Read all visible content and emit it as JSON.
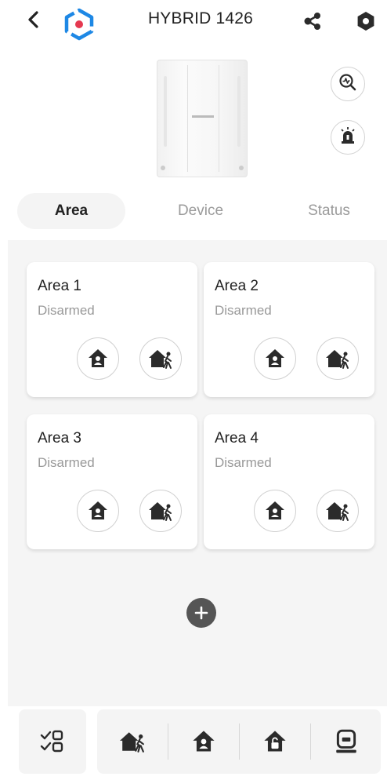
{
  "header": {
    "title": "HYBRID 1426",
    "icons": {
      "back": "chevron-left-icon",
      "logo": "app-logo-icon",
      "share": "share-icon",
      "settings": "settings-hexagon-icon"
    }
  },
  "device_panel": {
    "buttons": [
      "diagnostics-icon",
      "siren-icon"
    ]
  },
  "tabs": [
    {
      "label": "Area",
      "active": true
    },
    {
      "label": "Device",
      "active": false
    },
    {
      "label": "Status",
      "active": false
    }
  ],
  "areas": [
    {
      "name": "Area 1",
      "status": "Disarmed"
    },
    {
      "name": "Area 2",
      "status": "Disarmed"
    },
    {
      "name": "Area 3",
      "status": "Disarmed"
    },
    {
      "name": "Area 4",
      "status": "Disarmed"
    }
  ],
  "bottom_bar": {
    "items": [
      "select-multiple-icon",
      "away-arm-icon",
      "stay-arm-icon",
      "disarm-icon",
      "clear-alarm-icon"
    ]
  },
  "colors": {
    "logo_blue": "#1e88e5",
    "logo_red": "#e53950",
    "dark_icon": "#2b2b2b",
    "background_gray": "#f5f5f5"
  }
}
